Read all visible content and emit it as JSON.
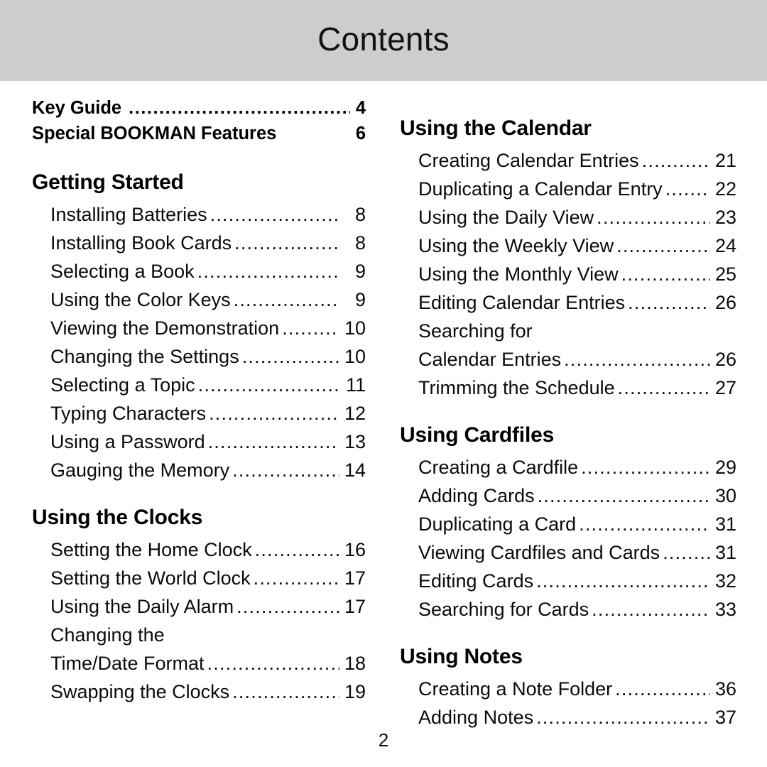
{
  "header": {
    "title": "Contents",
    "band_color": "#cdcdcd"
  },
  "footer": {
    "page_number": "2"
  },
  "dot_leader": "..........................................................................",
  "left_column": {
    "front_matter": [
      {
        "label": "Key Guide",
        "page": "4",
        "dots": true
      },
      {
        "label": "Special BOOKMAN Features",
        "page": "6",
        "dots": false
      }
    ],
    "sections": [
      {
        "heading": "Getting Started",
        "entries": [
          {
            "lines": [
              "Installing Batteries"
            ],
            "page": "8"
          },
          {
            "lines": [
              "Installing Book Cards"
            ],
            "page": "8"
          },
          {
            "lines": [
              "Selecting a Book"
            ],
            "page": "9"
          },
          {
            "lines": [
              "Using the Color Keys"
            ],
            "page": "9"
          },
          {
            "lines": [
              "Viewing the Demonstration"
            ],
            "page": "10"
          },
          {
            "lines": [
              "Changing the Settings"
            ],
            "page": "10"
          },
          {
            "lines": [
              "Selecting a Topic"
            ],
            "page": "11"
          },
          {
            "lines": [
              "Typing Characters"
            ],
            "page": "12"
          },
          {
            "lines": [
              "Using a Password"
            ],
            "page": "13"
          },
          {
            "lines": [
              "Gauging the Memory"
            ],
            "page": "14"
          }
        ]
      },
      {
        "heading": "Using the Clocks",
        "entries": [
          {
            "lines": [
              "Setting the Home Clock"
            ],
            "page": "16"
          },
          {
            "lines": [
              "Setting the World Clock"
            ],
            "page": "17"
          },
          {
            "lines": [
              "Using the Daily Alarm"
            ],
            "page": "17"
          },
          {
            "lines": [
              "Changing the",
              "Time/Date Format"
            ],
            "page": "18"
          },
          {
            "lines": [
              "Swapping the Clocks"
            ],
            "page": "19"
          }
        ]
      }
    ]
  },
  "right_column": {
    "front_matter": [],
    "sections": [
      {
        "heading": "Using the Calendar",
        "entries": [
          {
            "lines": [
              "Creating Calendar Entries"
            ],
            "page": "21"
          },
          {
            "lines": [
              "Duplicating a Calendar Entry"
            ],
            "page": "22"
          },
          {
            "lines": [
              "Using the Daily View"
            ],
            "page": "23"
          },
          {
            "lines": [
              "Using the Weekly View"
            ],
            "page": "24"
          },
          {
            "lines": [
              "Using the Monthly View"
            ],
            "page": "25"
          },
          {
            "lines": [
              "Editing Calendar Entries"
            ],
            "page": "26"
          },
          {
            "lines": [
              "Searching for",
              "Calendar Entries"
            ],
            "page": "26"
          },
          {
            "lines": [
              "Trimming the Schedule"
            ],
            "page": "27"
          }
        ]
      },
      {
        "heading": "Using Cardfiles",
        "entries": [
          {
            "lines": [
              "Creating a Cardfile"
            ],
            "page": "29"
          },
          {
            "lines": [
              "Adding Cards"
            ],
            "page": "30"
          },
          {
            "lines": [
              "Duplicating a Card"
            ],
            "page": "31"
          },
          {
            "lines": [
              "Viewing Cardfiles and Cards"
            ],
            "page": "31"
          },
          {
            "lines": [
              "Editing Cards"
            ],
            "page": "32"
          },
          {
            "lines": [
              "Searching for Cards"
            ],
            "page": "33"
          }
        ]
      },
      {
        "heading": "Using Notes",
        "entries": [
          {
            "lines": [
              "Creating a Note Folder"
            ],
            "page": "36"
          },
          {
            "lines": [
              "Adding Notes"
            ],
            "page": "37"
          }
        ]
      }
    ]
  }
}
